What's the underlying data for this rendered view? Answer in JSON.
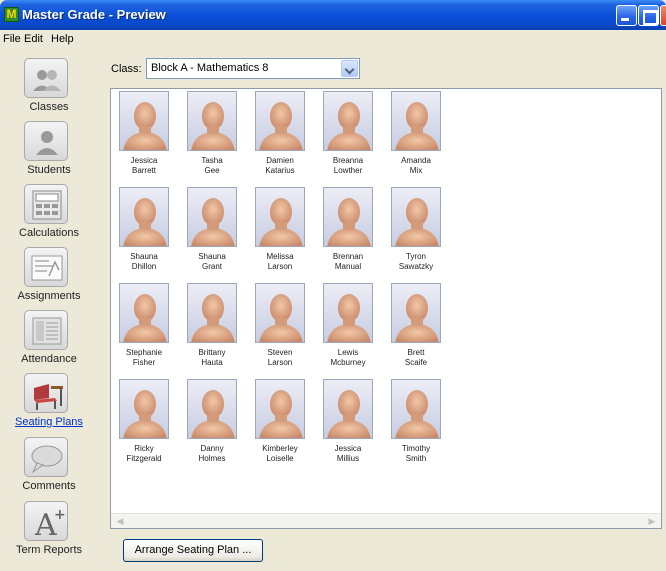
{
  "window": {
    "title": "Master Grade - Preview"
  },
  "menu": [
    "File",
    "Edit",
    "Help"
  ],
  "sidebar": {
    "items": [
      {
        "label": "Classes",
        "icon": "classes-icon"
      },
      {
        "label": "Students",
        "icon": "student-icon"
      },
      {
        "label": "Calculations",
        "icon": "calculator-icon"
      },
      {
        "label": "Assignments",
        "icon": "assignment-icon"
      },
      {
        "label": "Attendance",
        "icon": "attendance-icon"
      },
      {
        "label": "Seating Plans",
        "icon": "desk-chair-icon",
        "active": true
      },
      {
        "label": "Comments",
        "icon": "speech-bubble-icon"
      },
      {
        "label": "Term Reports",
        "icon": "grade-a-plus-icon"
      }
    ]
  },
  "class_selector": {
    "label": "Class:",
    "value": "Block A - Mathematics 8"
  },
  "students": [
    {
      "first": "Jessica",
      "last": "Barrett"
    },
    {
      "first": "Tasha",
      "last": "Gee"
    },
    {
      "first": "Damien",
      "last": "Katarius"
    },
    {
      "first": "Breanna",
      "last": "Lowther"
    },
    {
      "first": "Amanda",
      "last": "Mix"
    },
    {
      "first": "Shauna",
      "last": "Dhillon"
    },
    {
      "first": "Shauna",
      "last": "Grant"
    },
    {
      "first": "Melissa",
      "last": "Larson"
    },
    {
      "first": "Brennan",
      "last": "Manual"
    },
    {
      "first": "Tyron",
      "last": "Sawatzky"
    },
    {
      "first": "Stephanie",
      "last": "Fisher"
    },
    {
      "first": "Brittany",
      "last": "Hauta"
    },
    {
      "first": "Steven",
      "last": "Larson"
    },
    {
      "first": "Lewis",
      "last": "Mcburney"
    },
    {
      "first": "Brett",
      "last": "Scaife"
    },
    {
      "first": "Ricky",
      "last": "Fitzgerald"
    },
    {
      "first": "Danny",
      "last": "Holmes"
    },
    {
      "first": "Kimberley",
      "last": "Loiselle"
    },
    {
      "first": "Jessica",
      "last": "Millius"
    },
    {
      "first": "Timothy",
      "last": "Smith"
    }
  ],
  "buttons": {
    "arrange": "Arrange Seating Plan ..."
  }
}
